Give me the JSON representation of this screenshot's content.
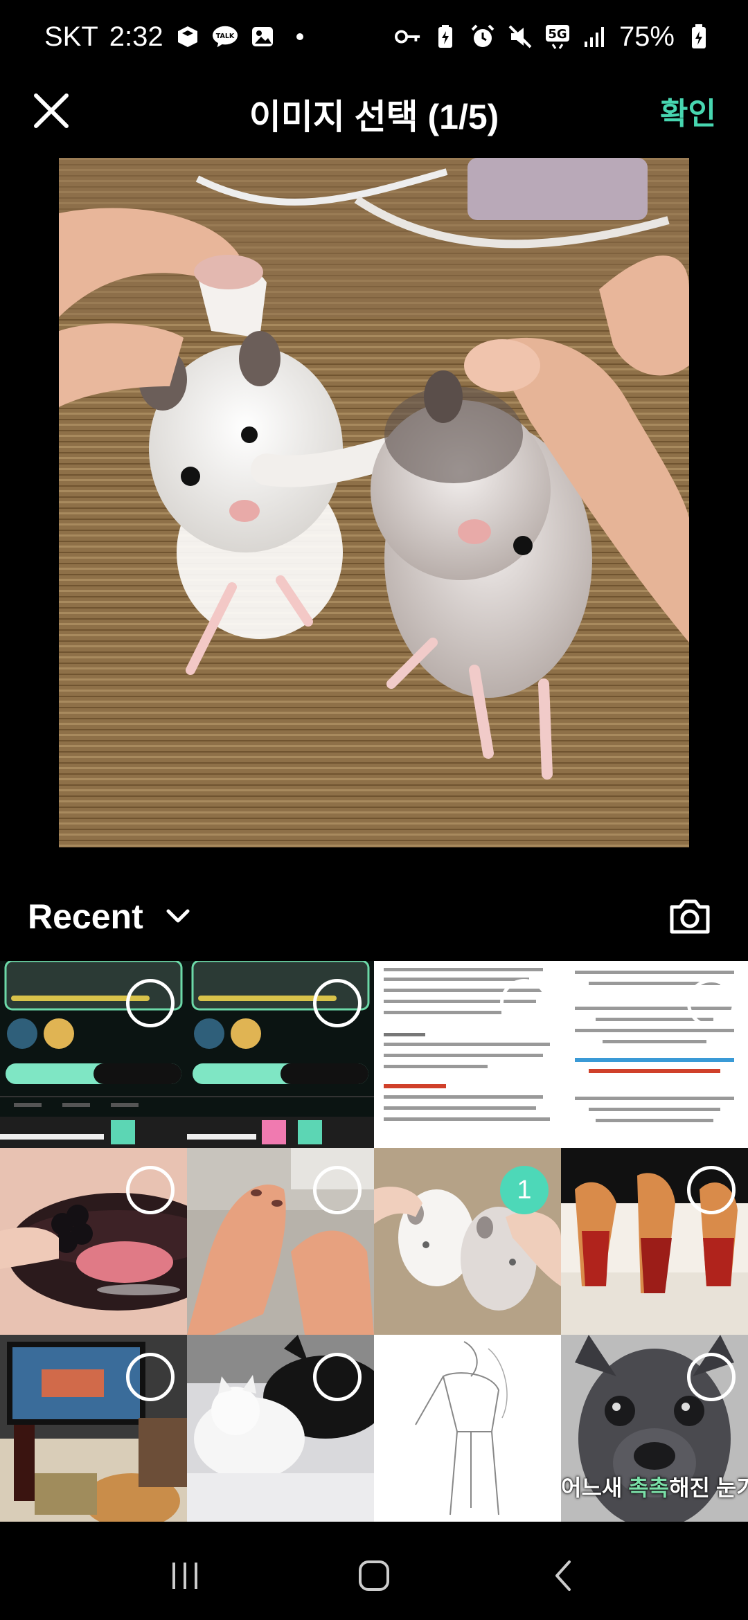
{
  "status_bar": {
    "carrier": "SKT",
    "time": "2:32",
    "talk_label": "TALK",
    "network": "5G",
    "battery": "75%"
  },
  "header": {
    "title": "이미지 선택 (1/5)",
    "confirm_label": "확인"
  },
  "album": {
    "name": "Recent"
  },
  "thumbnails": [
    {
      "kind": "screenshot-app",
      "selected": false
    },
    {
      "kind": "screenshot-app",
      "selected": false
    },
    {
      "kind": "screenshot-document",
      "selected": false
    },
    {
      "kind": "screenshot-document",
      "selected": false
    },
    {
      "kind": "photo-lips",
      "selected": false
    },
    {
      "kind": "photo-hands",
      "selected": false
    },
    {
      "kind": "photo-hamsters",
      "selected": true,
      "selection_number": "1"
    },
    {
      "kind": "illustration",
      "selected": false
    },
    {
      "kind": "photo-desk",
      "selected": false
    },
    {
      "kind": "photo-cat-dog",
      "selected": false
    },
    {
      "kind": "sketch",
      "selected": false
    },
    {
      "kind": "photo-dog",
      "selected": false,
      "caption_prefix": "어느새 ",
      "caption_highlight": "촉촉",
      "caption_suffix": "해진 눈가.."
    }
  ],
  "colors": {
    "accent": "#47d6b0",
    "selected_badge": "#4dd8b8",
    "background": "#000000"
  }
}
